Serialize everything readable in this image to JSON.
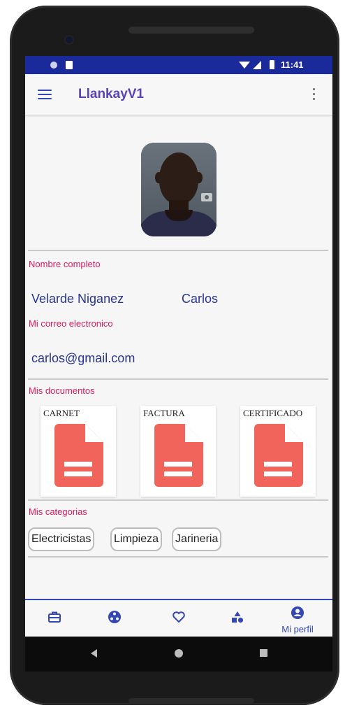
{
  "status_bar": {
    "time": "11:41"
  },
  "app_bar": {
    "title": "LlankayV1",
    "menu_icon": "hamburger-menu-icon",
    "overflow_icon": "more-vert-icon"
  },
  "profile": {
    "name_label": "Nombre completo",
    "last_name": "Velarde Niganez",
    "first_name": "Carlos",
    "email_label": "Mi correo electronico",
    "email": "carlos@gmail.com"
  },
  "documents": {
    "label": "Mis documentos",
    "items": [
      {
        "title": "CARNET",
        "icon": "file-document-icon"
      },
      {
        "title": "FACTURA",
        "icon": "file-document-icon"
      },
      {
        "title": "CERTIFICADO",
        "icon": "file-document-icon"
      }
    ]
  },
  "categories": {
    "label": "Mis categorias",
    "items": [
      "Electricistas",
      "Limpieza",
      "Jarineria"
    ]
  },
  "bottom_nav": {
    "items": [
      {
        "icon": "briefcase-icon",
        "label": ""
      },
      {
        "icon": "network-icon",
        "label": ""
      },
      {
        "icon": "heart-icon",
        "label": ""
      },
      {
        "icon": "shapes-icon",
        "label": ""
      },
      {
        "icon": "account-circle-icon",
        "label": "Mi perfil",
        "active": true
      }
    ]
  },
  "colors": {
    "primary": "#3347b5",
    "accent": "#d81b60",
    "title": "#5a41b8",
    "file_icon": "#f0645c"
  }
}
